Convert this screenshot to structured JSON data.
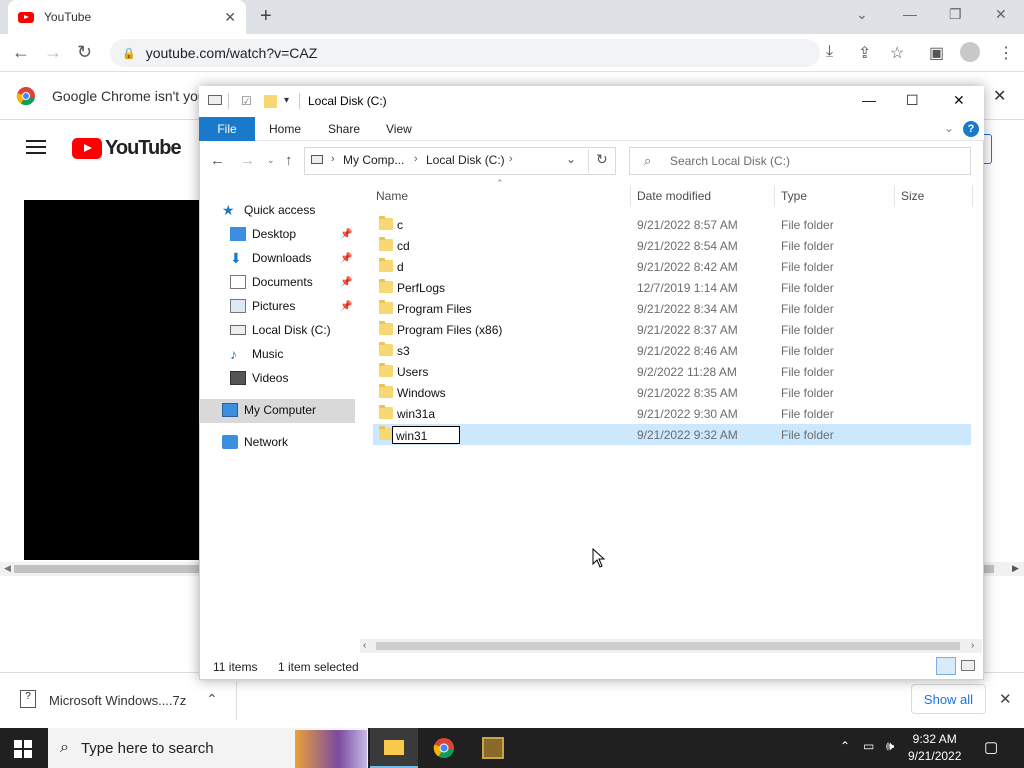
{
  "chrome": {
    "tab_title": "YouTube",
    "tab_close": "✕",
    "new_tab": "+",
    "url": "youtube.com/watch?v=CAZ",
    "infobar_text": "Google Chrome isn't your"
  },
  "youtube": {
    "logo_text": "YouTube"
  },
  "downloads": {
    "file_name": "Microsoft Windows....7z",
    "show_all": "Show all"
  },
  "taskbar": {
    "search_placeholder": "Type here to search",
    "time": "9:32 AM",
    "date": "9/21/2022"
  },
  "explorer": {
    "title": "Local Disk (C:)",
    "ribbon_tabs": [
      "File",
      "Home",
      "Share",
      "View"
    ],
    "help": "?",
    "breadcrumb": [
      "My Comp...",
      "Local Disk (C:)"
    ],
    "search_placeholder": "Search Local Disk (C:)",
    "nav": [
      {
        "label": "Quick access",
        "pinned": false
      },
      {
        "label": "Desktop",
        "pinned": true
      },
      {
        "label": "Downloads",
        "pinned": true
      },
      {
        "label": "Documents",
        "pinned": true
      },
      {
        "label": "Pictures",
        "pinned": true
      },
      {
        "label": "Local Disk (C:)",
        "pinned": false
      },
      {
        "label": "Music",
        "pinned": false
      },
      {
        "label": "Videos",
        "pinned": false
      },
      {
        "label": "My Computer",
        "pinned": false,
        "selected": true
      },
      {
        "label": "Network",
        "pinned": false
      }
    ],
    "columns": [
      "Name",
      "Date modified",
      "Type",
      "Size"
    ],
    "files": [
      {
        "name": "c",
        "date": "9/21/2022 8:57 AM",
        "type": "File folder"
      },
      {
        "name": "cd",
        "date": "9/21/2022 8:54 AM",
        "type": "File folder"
      },
      {
        "name": "d",
        "date": "9/21/2022 8:42 AM",
        "type": "File folder"
      },
      {
        "name": "PerfLogs",
        "date": "12/7/2019 1:14 AM",
        "type": "File folder"
      },
      {
        "name": "Program Files",
        "date": "9/21/2022 8:34 AM",
        "type": "File folder"
      },
      {
        "name": "Program Files (x86)",
        "date": "9/21/2022 8:37 AM",
        "type": "File folder"
      },
      {
        "name": "s3",
        "date": "9/21/2022 8:46 AM",
        "type": "File folder"
      },
      {
        "name": "Users",
        "date": "9/2/2022 11:28 AM",
        "type": "File folder"
      },
      {
        "name": "Windows",
        "date": "9/21/2022 8:35 AM",
        "type": "File folder"
      },
      {
        "name": "win31a",
        "date": "9/21/2022 9:30 AM",
        "type": "File folder"
      },
      {
        "name": "win31",
        "date": "9/21/2022 9:32 AM",
        "type": "File folder",
        "selected": true,
        "renaming": true
      }
    ],
    "status_items": "11 items",
    "status_selected": "1 item selected"
  }
}
